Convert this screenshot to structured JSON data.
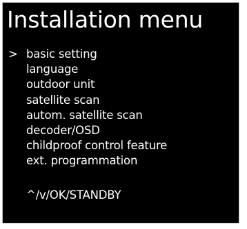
{
  "menu": {
    "title": "Installation menu",
    "cursor": ">",
    "items": [
      {
        "label": "basic setting"
      },
      {
        "label": "language"
      },
      {
        "label": "outdoor unit"
      },
      {
        "label": "satellite scan"
      },
      {
        "label": "autom. satellite scan"
      },
      {
        "label": "decoder/OSD"
      },
      {
        "label": "childproof control feature"
      },
      {
        "label": "ext. programmation"
      }
    ],
    "selected_index": 0,
    "nav_hint": "^/v/OK/STANDBY"
  },
  "colors": {
    "background": "#000000",
    "text": "#ffffff",
    "frame_border": "#bdbdbd"
  }
}
